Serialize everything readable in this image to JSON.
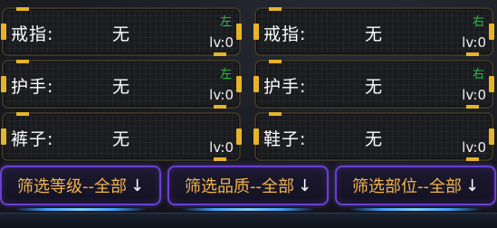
{
  "slots": [
    {
      "label": "戒指:",
      "value": "无",
      "level": "lv:0",
      "side": "左"
    },
    {
      "label": "戒指:",
      "value": "无",
      "level": "lv:0",
      "side": "右"
    },
    {
      "label": "护手:",
      "value": "无",
      "level": "lv:0",
      "side": "左"
    },
    {
      "label": "护手:",
      "value": "无",
      "level": "lv:0",
      "side": "右"
    },
    {
      "label": "裤子:",
      "value": "无",
      "level": "lv:0",
      "side": ""
    },
    {
      "label": "鞋子:",
      "value": "无",
      "level": "lv:0",
      "side": ""
    }
  ],
  "filters": {
    "level": "筛选等级--全部",
    "quality": "筛选品质--全部",
    "part": "筛选部位--全部",
    "arrow": "↓"
  },
  "colors": {
    "accent_gold": "#e7b429",
    "side_green": "#27c24a",
    "filter_text": "#f2b54a",
    "filter_border": "#6b3fd0"
  }
}
